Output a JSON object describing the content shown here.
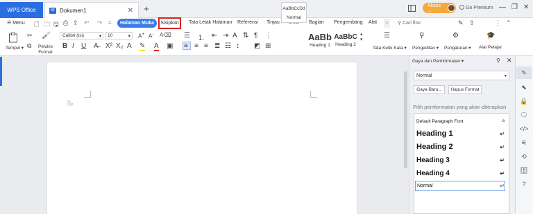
{
  "titlebar": {
    "wps_tab": "WPS Office",
    "doc_badge": "W",
    "doc_tab": "Dokumen1",
    "close_tab": "✕",
    "add_tab": "+",
    "akses": "Akses ...",
    "premium": "Go Premium",
    "win_minimize": "—",
    "win_restore": "❐",
    "win_close": "✕"
  },
  "menubar": {
    "menu_label": "Menu",
    "tabs": [
      "Halaman Muka",
      "Sisipkan",
      "Tata Letak Halaman",
      "Referensi",
      "Tinjau",
      "Lihat",
      "Bagian",
      "Pengembang",
      "Alat"
    ],
    "search": "Cari fitur"
  },
  "ribbon": {
    "tempel": "Tempel",
    "pelukis": "Pelukis",
    "format": "Format",
    "font_name": "Calibri (Isi)",
    "font_size": "10",
    "styles": [
      {
        "preview": "AaBbCcDd",
        "label": "Normal"
      },
      {
        "preview": "AaBb",
        "label": "Heading 1"
      },
      {
        "preview": "AaBbC",
        "label": "Heading 2"
      }
    ],
    "tata_ketik": "Tata Ketik Kata",
    "pengeditan": "Pengeditan",
    "pengaturan": "Pengaturan",
    "alat_pelajar": "Alat Pelajar"
  },
  "pane": {
    "title": "Gaya dan Pemformatan",
    "current_style": "Normal",
    "new_style": "Gaya Baru...",
    "clear_format": "Hapus Format",
    "hint": "Pilih pemformatan yang akan diterapkan",
    "styles": [
      {
        "name": "Default Paragraph Font",
        "mark": "a"
      },
      {
        "name": "Heading 1",
        "mark": "↵"
      },
      {
        "name": "Heading 2",
        "mark": "↵"
      },
      {
        "name": "Heading 3",
        "mark": "↵"
      },
      {
        "name": "Heading 4",
        "mark": "↵"
      },
      {
        "name": "Normal",
        "mark": "↵"
      }
    ]
  }
}
